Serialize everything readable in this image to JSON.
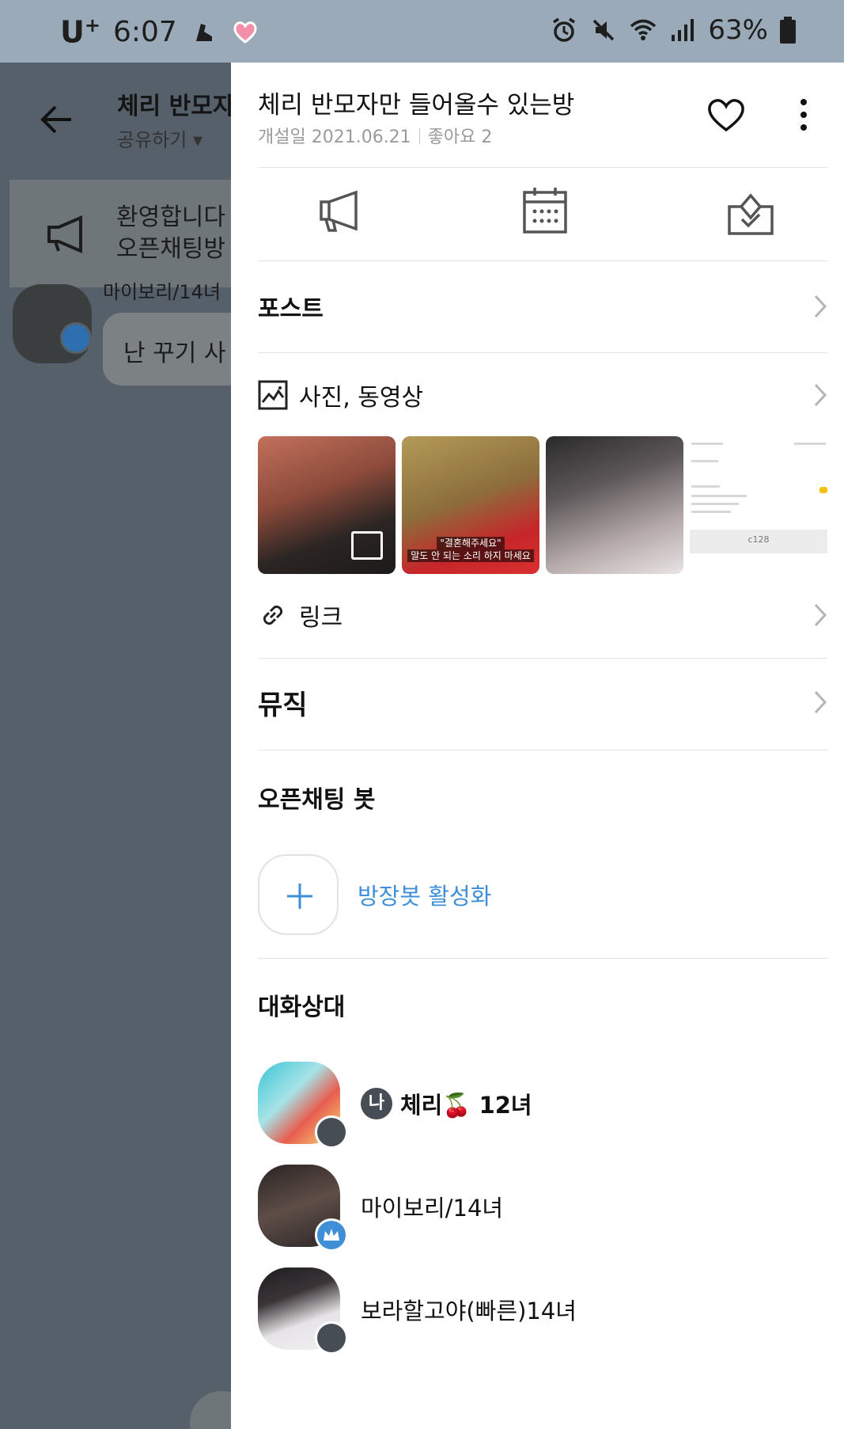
{
  "status_bar": {
    "carrier": "U",
    "carrier_sup": "+",
    "time": "6:07",
    "battery": "63%"
  },
  "chat_background": {
    "title": "체리 반모자",
    "share_label": "공유하기 ▾",
    "notice_line1": "환영합니다",
    "notice_line2": "오픈채팅방",
    "sender_name": "마이보리/14녀",
    "message": "난 꾸기 사"
  },
  "drawer": {
    "room_title": "체리 반모자만 들어올수 있는방",
    "created_label": "개설일 2021.06.21",
    "likes_label": "좋아요 2",
    "tools": [
      "notice-icon",
      "calendar-icon",
      "vote-icon"
    ],
    "rows": {
      "post": "포스트",
      "media": "사진, 동영상",
      "link": "링크",
      "music": "뮤직"
    },
    "thumbnails": {
      "t2_caption1": "\"결혼해주세요\"",
      "t2_caption2": "말도 안 되는 소리 하지 마세요",
      "t4_code": "c128"
    },
    "bot_section": {
      "title": "오픈채팅 봇",
      "activate_label": "방장봇 활성화"
    },
    "members_section": {
      "title": "대화상대",
      "me_tag": "나",
      "members": [
        {
          "name": "체리🍒 12녀",
          "badge": "gray"
        },
        {
          "name": "마이보리/14녀",
          "badge": "blue"
        },
        {
          "name": "보라할고야(빠른)14녀",
          "badge": "gray"
        }
      ]
    },
    "colors": {
      "accent_blue": "#3e8fd8",
      "badge_gray": "#474d55",
      "overlay": "#56606b"
    }
  }
}
